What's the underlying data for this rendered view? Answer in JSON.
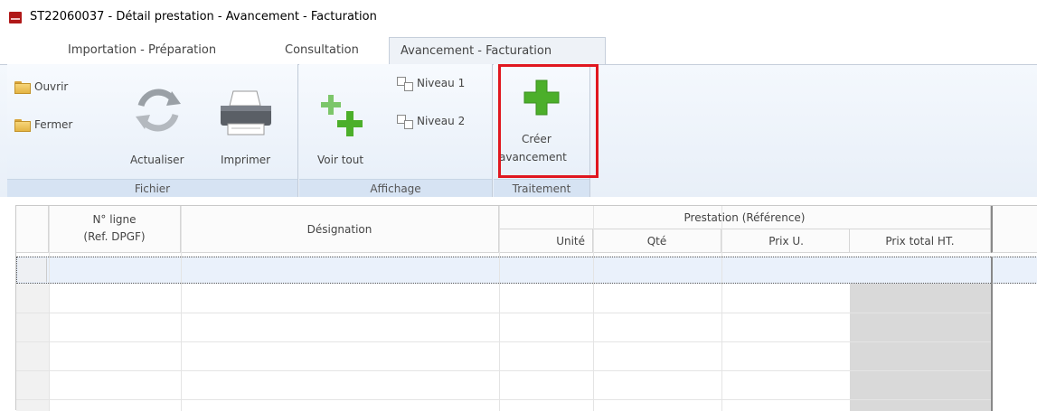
{
  "window": {
    "title": "ST22060037 - Détail prestation -  Avancement - Facturation"
  },
  "tabs": [
    {
      "label": "Importation - Préparation"
    },
    {
      "label": "Consultation"
    },
    {
      "label": "Avancement - Facturation"
    }
  ],
  "ribbon": {
    "fichier": {
      "label": "Fichier",
      "ouvrir": "Ouvrir",
      "fermer": "Fermer",
      "actualiser": "Actualiser",
      "imprimer": "Imprimer"
    },
    "affichage": {
      "label": "Affichage",
      "voir_tout": "Voir tout",
      "niveau1": "Niveau 1",
      "niveau2": "Niveau 2"
    },
    "traitement": {
      "label": "Traitement",
      "creer_line1": "Créer",
      "creer_line2": "avancement"
    }
  },
  "grid": {
    "col_ligne_1": "N° ligne",
    "col_ligne_2": "(Ref. DPGF)",
    "col_designation": "Désignation",
    "group_prestation": "Prestation (Référence)",
    "col_unite": "Unité",
    "col_qte": "Qté",
    "col_prix_u": "Prix U.",
    "col_prix_total": "Prix total HT."
  },
  "colors": {
    "highlight": "#e0171f",
    "accent_green": "#4caf2a"
  }
}
